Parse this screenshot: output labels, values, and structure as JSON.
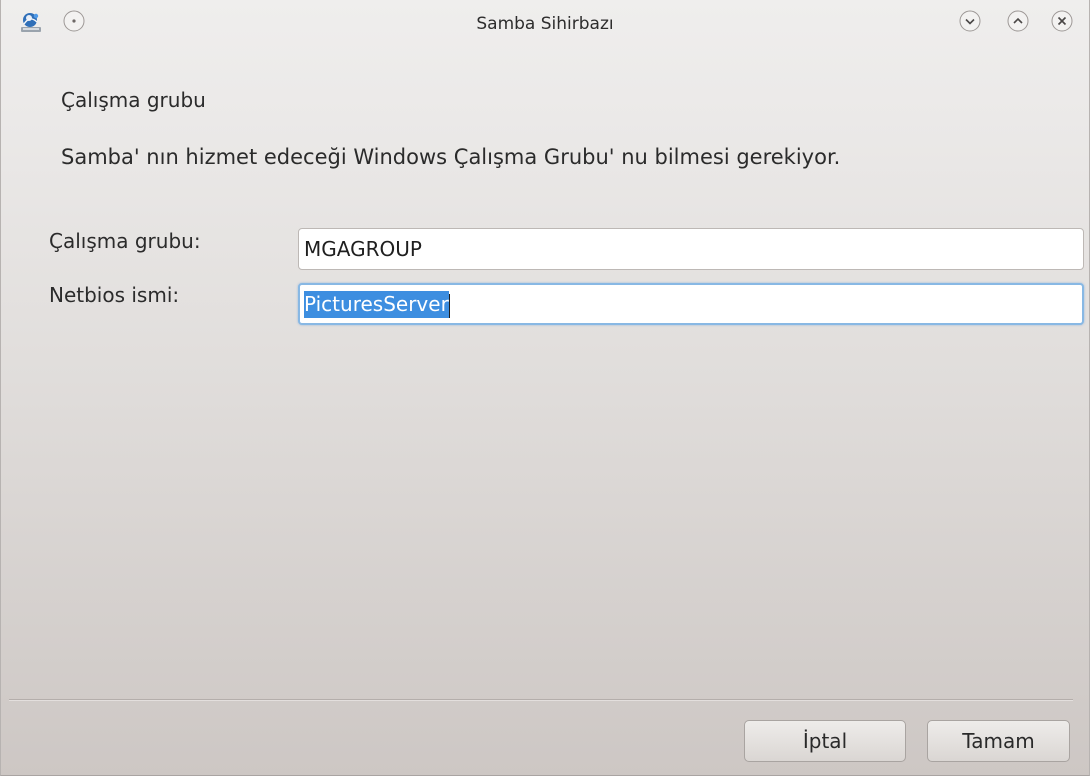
{
  "window": {
    "title": "Samba Sihirbazı"
  },
  "titlebar_icons": {
    "app": "samba-wizard-app-icon",
    "menu": "window-menu-icon",
    "minimize": "minimize-icon",
    "maximize": "maximize-icon",
    "close": "close-icon"
  },
  "page": {
    "heading": "Çalışma grubu",
    "description": "Samba' nın hizmet edeceği Windows Çalışma Grubu' nu bilmesi gerekiyor."
  },
  "form": {
    "workgroup": {
      "label": "Çalışma grubu:",
      "value": "MGAGROUP"
    },
    "netbios": {
      "label": "Netbios ismi:",
      "value": "PicturesServer",
      "selected": true,
      "focused": true
    }
  },
  "buttons": {
    "cancel": "İptal",
    "ok": "Tamam"
  },
  "colors": {
    "selection": "#3d8ee0",
    "focus_ring": "#88b8e4"
  }
}
